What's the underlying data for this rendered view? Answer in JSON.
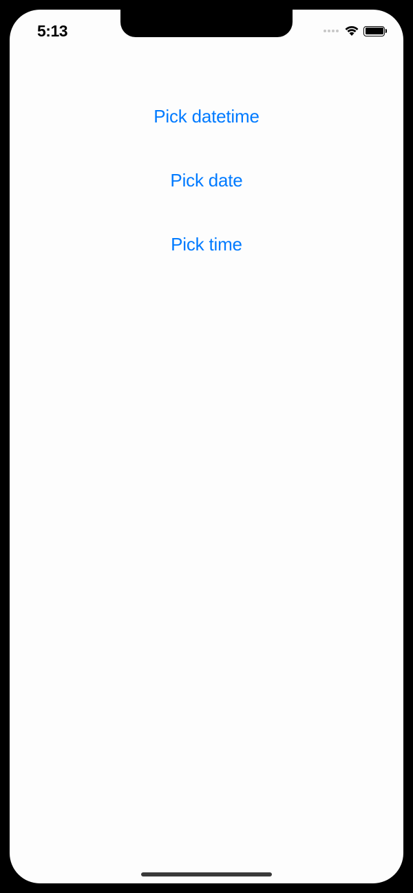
{
  "status_bar": {
    "time": "5:13"
  },
  "actions": {
    "pick_datetime": "Pick datetime",
    "pick_date": "Pick date",
    "pick_time": "Pick time"
  }
}
